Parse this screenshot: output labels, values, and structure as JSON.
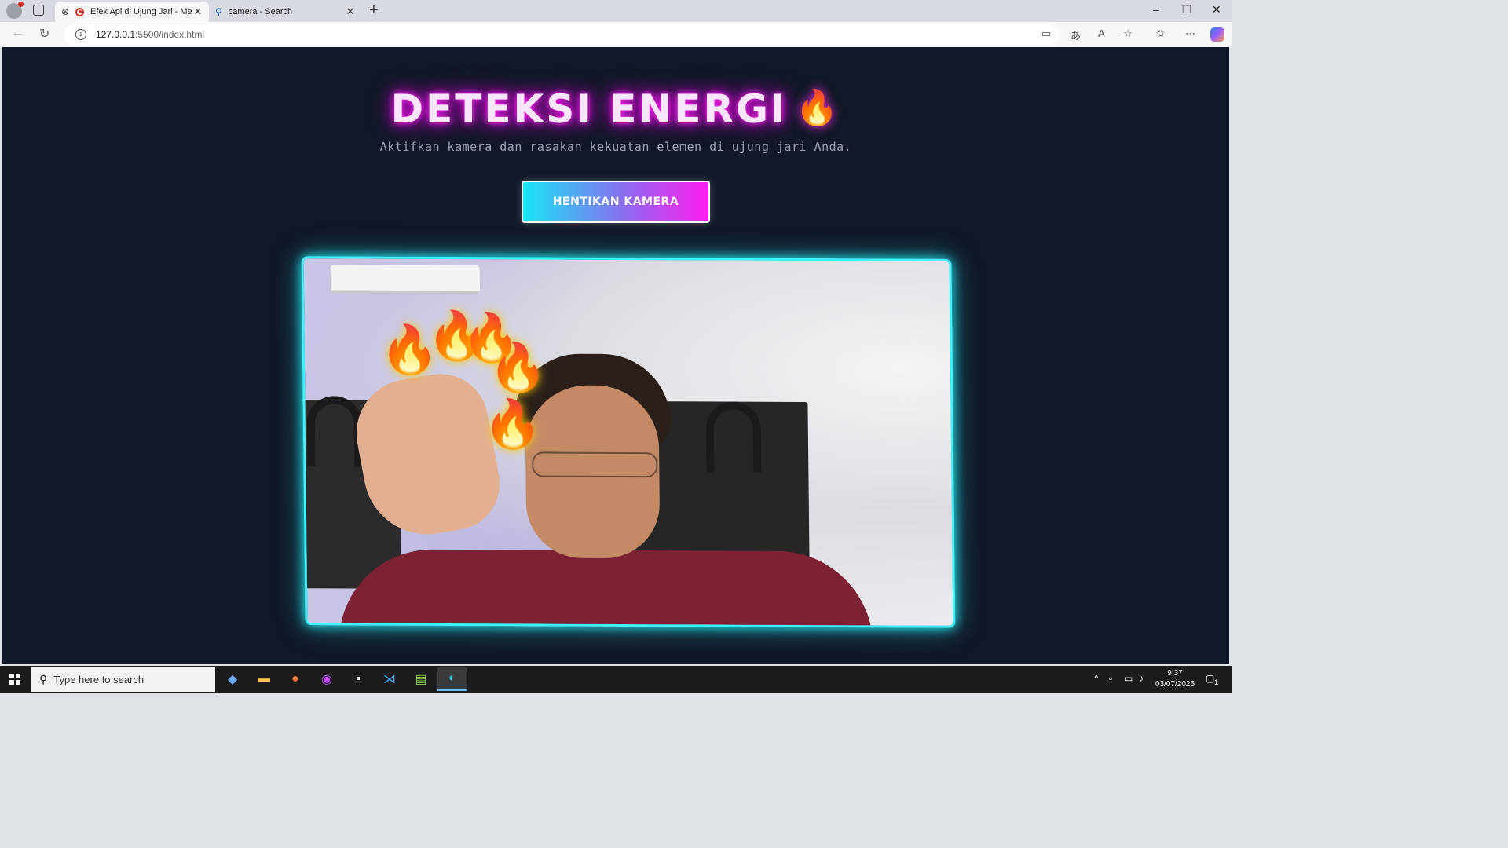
{
  "browser": {
    "tabs": [
      {
        "title": "Efek Api di Ujung Jari - Medi",
        "active": true
      },
      {
        "title": "camera - Search",
        "active": false
      }
    ],
    "new_tab_glyph": "+",
    "url_host": "127.0.0.1",
    "url_rest": ":5500/index.html",
    "window_controls": {
      "minimize": "–",
      "restore": "❐",
      "close": "✕"
    }
  },
  "page": {
    "title": "DETEKSI ENERGI",
    "title_emoji": "🔥",
    "subtitle": "Aktifkan kamera dan rasakan kekuatan elemen di ujung jari Anda.",
    "camera_button": "HENTIKAN KAMERA",
    "effect_emoji": "🔥",
    "fingertip_effects": 5,
    "colors": {
      "neon_pink": "#ff2cf0",
      "neon_cyan": "#3ff3ff",
      "background": "#111827"
    }
  },
  "taskbar": {
    "search_placeholder": "Type here to search",
    "time": "9:37",
    "date": "03/07/2025",
    "notification_count": "1",
    "pinned_apps": [
      "copilot-icon",
      "file-explorer-icon",
      "firefox-icon",
      "browser-icon",
      "terminal-icon",
      "vscode-icon",
      "notepad-icon",
      "edge-icon"
    ]
  }
}
